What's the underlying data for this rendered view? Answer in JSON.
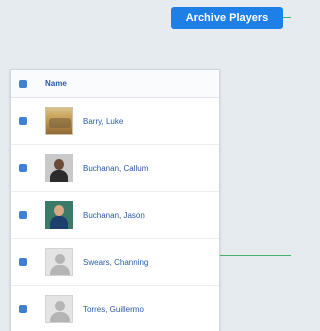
{
  "toolbar": {
    "archive_label": "Archive Players"
  },
  "table": {
    "header": "Name",
    "rows": [
      {
        "name": "Barry, Luke",
        "photo": "team-photo"
      },
      {
        "name": "Buchanan, Callum",
        "photo": "player-photo"
      },
      {
        "name": "Buchanan, Jason",
        "photo": "player-photo"
      },
      {
        "name": "Swears, Channing",
        "photo": "placeholder-avatar"
      },
      {
        "name": "Torres, Guillermo",
        "photo": "placeholder-avatar"
      }
    ]
  },
  "colors": {
    "accent": "#1e7fe6",
    "link": "#2b5aa8",
    "connector": "#44b36a",
    "background": "#e6ebf0"
  }
}
